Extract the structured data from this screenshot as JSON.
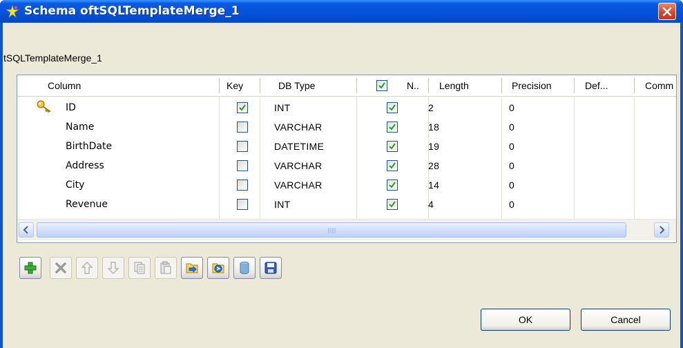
{
  "window": {
    "title": "Schema oftSQLTemplateMerge_1",
    "subtitle": "tSQLTemplateMerge_1"
  },
  "table": {
    "columns": [
      "Column",
      "Key",
      "DB Type",
      "N..",
      "Length",
      "Precision",
      "Def...",
      "Comm"
    ],
    "rows": [
      {
        "column": "ID",
        "key": true,
        "db_type": "INT",
        "nullable": true,
        "length": "2",
        "precision": "0",
        "is_key_icon": "key-icon"
      },
      {
        "column": "Name",
        "key": false,
        "db_type": "VARCHAR",
        "nullable": true,
        "length": "18",
        "precision": "0"
      },
      {
        "column": "BirthDate",
        "key": false,
        "db_type": "DATETIME",
        "nullable": true,
        "length": "19",
        "precision": "0"
      },
      {
        "column": "Address",
        "key": false,
        "db_type": "VARCHAR",
        "nullable": true,
        "length": "28",
        "precision": "0"
      },
      {
        "column": "City",
        "key": false,
        "db_type": "VARCHAR",
        "nullable": true,
        "length": "14",
        "precision": "0"
      },
      {
        "column": "Revenue",
        "key": false,
        "db_type": "INT",
        "nullable": true,
        "length": "4",
        "precision": "0"
      }
    ],
    "nullable_header_checked": true
  },
  "toolbar": {
    "buttons": [
      {
        "name": "add-icon",
        "enabled": true
      },
      {
        "name": "remove-icon",
        "enabled": false
      },
      {
        "name": "move-up-icon",
        "enabled": false
      },
      {
        "name": "move-down-icon",
        "enabled": false
      },
      {
        "name": "copy-icon",
        "enabled": false
      },
      {
        "name": "paste-icon",
        "enabled": false
      },
      {
        "name": "import-icon",
        "enabled": true
      },
      {
        "name": "export-icon",
        "enabled": true
      },
      {
        "name": "database-icon",
        "enabled": true
      },
      {
        "name": "save-icon",
        "enabled": true
      }
    ]
  },
  "buttons": {
    "ok": "OK",
    "cancel": "Cancel"
  },
  "colors": {
    "titlebar": "#0550d9",
    "dialog_bg": "#ece9d8",
    "close": "#d2462a",
    "checkbox_check": "#21a121"
  }
}
